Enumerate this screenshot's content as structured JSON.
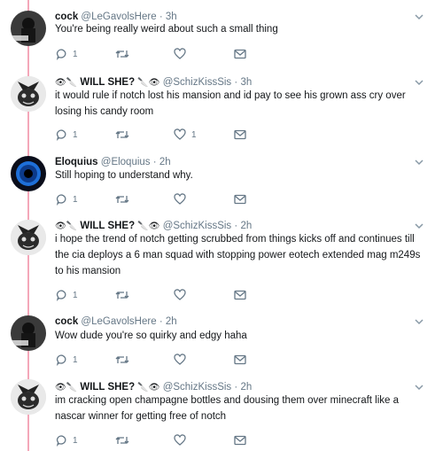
{
  "tweets": [
    {
      "avatar": "shadow-figure-avatar",
      "name": "cock",
      "handle": "@LeGavolsHere",
      "time": "3h",
      "emoji_before": "",
      "emoji_after": "",
      "text": "You're being really weird about such a small thing",
      "replies": "1",
      "retweets": "",
      "likes": ""
    },
    {
      "avatar": "cat-avatar",
      "name": "WILL SHE?",
      "handle": "@SchizKissSis",
      "time": "3h",
      "emoji_before": "👁🔪",
      "emoji_after": "🔪👁",
      "text": "it would rule if notch lost his mansion and id pay to see his grown ass cry over losing his candy room",
      "replies": "1",
      "retweets": "",
      "likes": "1"
    },
    {
      "avatar": "blue-eye-avatar",
      "name": "Eloquius",
      "handle": "@Eloquius",
      "time": "2h",
      "emoji_before": "",
      "emoji_after": "",
      "text": "Still hoping to understand why.",
      "replies": "1",
      "retweets": "",
      "likes": ""
    },
    {
      "avatar": "cat-avatar",
      "name": "WILL SHE?",
      "handle": "@SchizKissSis",
      "time": "2h",
      "emoji_before": "👁🔪",
      "emoji_after": "🔪👁",
      "text": "i hope the trend of notch getting scrubbed from things kicks off and continues till the cia deploys a 6 man squad with stopping power eotech extended mag m249s to his mansion",
      "replies": "1",
      "retweets": "",
      "likes": ""
    },
    {
      "avatar": "shadow-figure-avatar",
      "name": "cock",
      "handle": "@LeGavolsHere",
      "time": "2h",
      "emoji_before": "",
      "emoji_after": "",
      "text": "Wow dude you're so quirky and edgy haha",
      "replies": "1",
      "retweets": "",
      "likes": ""
    },
    {
      "avatar": "cat-avatar",
      "name": "WILL SHE?",
      "handle": "@SchizKissSis",
      "time": "2h",
      "emoji_before": "👁🔪",
      "emoji_after": "🔪👁",
      "text": "im cracking open champagne bottles and dousing them over minecraft like a nascar winner for getting free of notch",
      "replies": "1",
      "retweets": "",
      "likes": ""
    }
  ],
  "colors": {
    "thread_line": "#f4a7b9",
    "muted": "#657786",
    "text": "#14171a"
  }
}
